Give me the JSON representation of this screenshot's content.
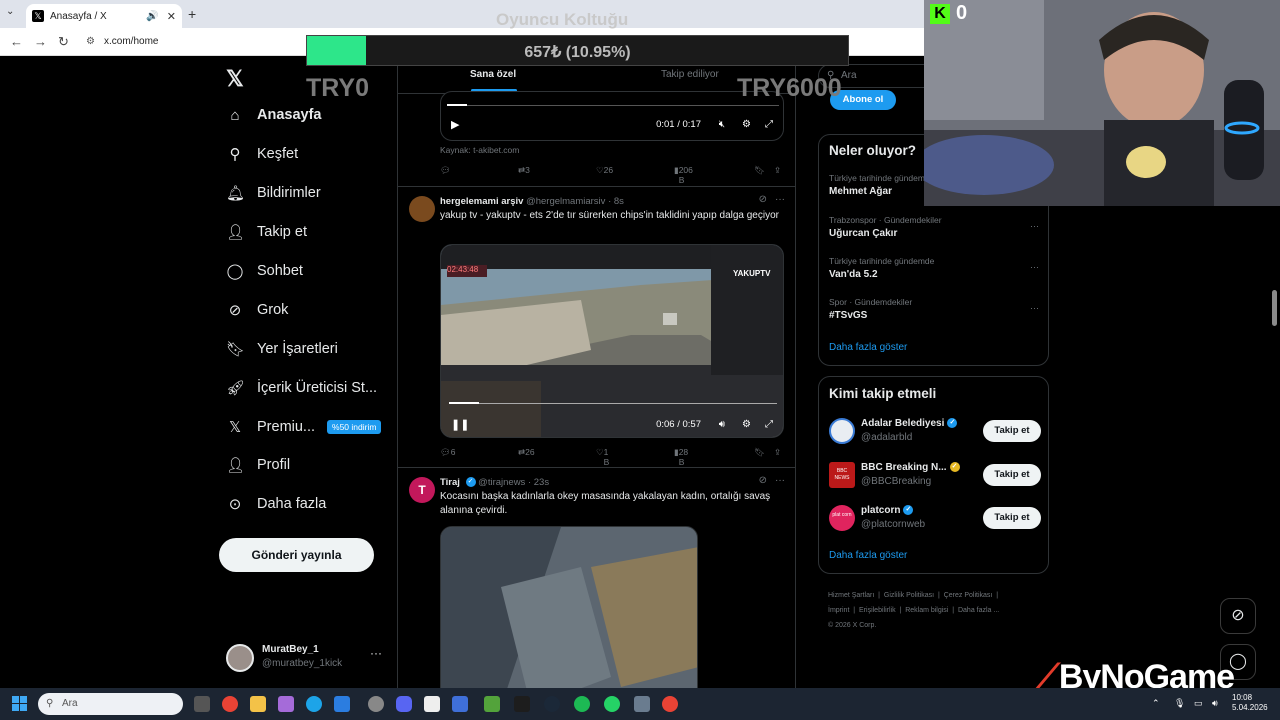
{
  "browser": {
    "tab_title": "Anasayfa / X",
    "tab_favicon": "𝕏",
    "url": "x.com/home"
  },
  "sidebar": {
    "logo": "𝕏",
    "items": [
      {
        "label": "Anasayfa",
        "icon": "home-icon"
      },
      {
        "label": "Keşfet",
        "icon": "search-icon"
      },
      {
        "label": "Bildirimler",
        "icon": "bell-icon"
      },
      {
        "label": "Takip et",
        "icon": "person-add-icon"
      },
      {
        "label": "Sohbet",
        "icon": "chat-icon"
      },
      {
        "label": "Grok",
        "icon": "grok-icon"
      },
      {
        "label": "Yer İşaretleri",
        "icon": "bookmark-icon"
      },
      {
        "label": "İçerik Üreticisi St...",
        "icon": "rocket-icon"
      },
      {
        "label": "Premiu...",
        "icon": "x-premium-icon",
        "badge": "%50 indirim"
      },
      {
        "label": "Profil",
        "icon": "person-icon"
      },
      {
        "label": "Daha fazla",
        "icon": "more-circle-icon"
      }
    ],
    "post_button": "Gönderi yayınla",
    "account": {
      "name": "MuratBey_1",
      "handle": "@muratbey_1kick"
    }
  },
  "feed": {
    "tabs": [
      "Sana özel",
      "Takip ediliyor"
    ],
    "post1": {
      "time": "0:01 / 0:17",
      "source": "Kaynak: t-akibet.com",
      "replies": "",
      "reposts": "3",
      "likes": "26",
      "views": "206 B"
    },
    "post2": {
      "name": "hergelemami arşiv",
      "handle": "@hergelmamiarsiv",
      "time_ago": "· 8s",
      "text": "yakup tv - yakuptv - ets 2'de tır sürerken chips'in taklidini yapıp dalga geçiyor",
      "video_time": "0:06 / 0:57",
      "video_timer": "02:43:48",
      "video_logo": "YAKUPTV",
      "replies": "6",
      "reposts": "26",
      "likes": "1 B",
      "views": "28 B"
    },
    "post3": {
      "name": "Tiraj",
      "handle": "@tirajnews",
      "time_ago": "· 23s",
      "avatar_letter": "T",
      "text": "Kocasını başka kadınlarla okey masasında yakalayan kadın, ortalığı savaş alanına çevirdi."
    }
  },
  "right": {
    "search_placeholder": "Ara",
    "subscribe": "Abone ol",
    "trends_title": "Neler oluyor?",
    "trends": [
      {
        "category": "Türkiye tarihinde gündem",
        "title": "Mehmet Ağar"
      },
      {
        "category": "Trabzonspor · Gündemdekiler",
        "title": "Uğurcan Çakır"
      },
      {
        "category": "Türkiye tarihinde gündemde",
        "title": "Van'da 5.2"
      },
      {
        "category": "Spor · Gündemdekiler",
        "title": "#TSvGS"
      }
    ],
    "show_more": "Daha fazla göster",
    "who_title": "Kimi takip etmeli",
    "who": [
      {
        "name": "Adalar Belediyesi",
        "handle": "@adalarbld",
        "avatar_color": "#e9edf2"
      },
      {
        "name": "BBC Breaking N...",
        "handle": "@BBCBreaking",
        "avatar_color": "#bb1919",
        "avatar_text": "BBC NEWS"
      },
      {
        "name": "platcorn",
        "handle": "@platcornweb",
        "avatar_color": "#e0245e",
        "avatar_text": "plat corn"
      }
    ],
    "follow_label": "Takip et",
    "who_more": "Daha fazla göster",
    "footer": [
      "Hizmet Şartları",
      "Gizlilik Politikası",
      "Çerez Politikası",
      "İmprint",
      "Erişilebilirlik",
      "Reklam bilgisi",
      "Daha fazla ...",
      "© 2026 X Corp."
    ]
  },
  "overlay": {
    "title": "Oyuncu Koltuğu",
    "progress_text": "657₺ (10.95%)",
    "progress_fraction": 0.1095,
    "goal_low": "TRY0",
    "goal_high": "TRY6000",
    "kick_count": "0",
    "kick_logo": "K",
    "brand": "ByNoGame",
    "bar_color": "#2de68a"
  },
  "taskbar": {
    "search_placeholder": "Ara",
    "time": "10:08",
    "date": "5.04.2026"
  }
}
